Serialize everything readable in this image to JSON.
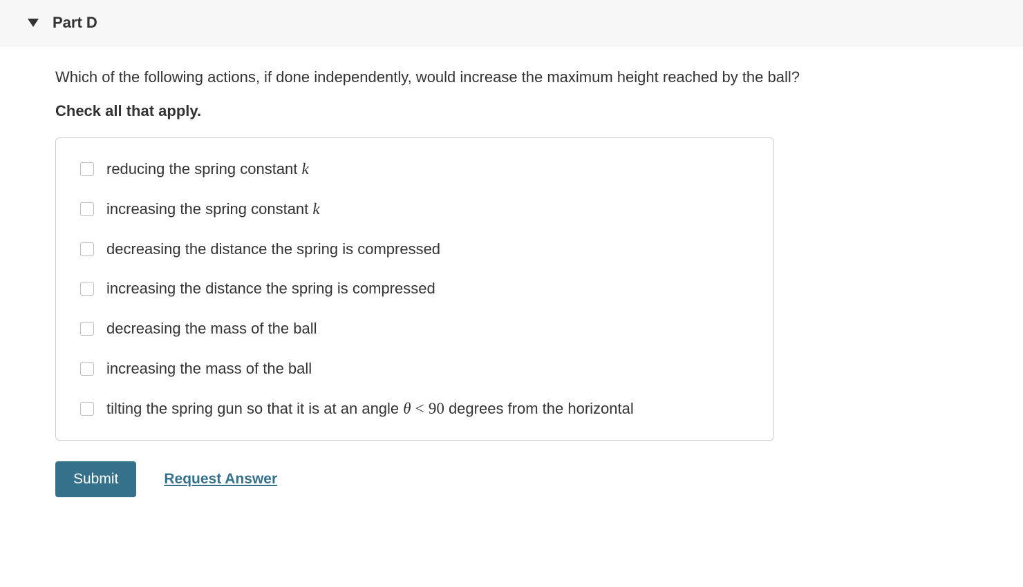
{
  "header": {
    "part_title": "Part D"
  },
  "question": {
    "text": "Which of the following actions, if done independently, would increase the maximum height reached by the ball?",
    "instruction": "Check all that apply."
  },
  "options": [
    {
      "text_before": "reducing the spring constant ",
      "math": "k",
      "text_after": ""
    },
    {
      "text_before": "increasing the spring constant ",
      "math": "k",
      "text_after": ""
    },
    {
      "text_before": "decreasing the distance the spring is compressed",
      "math": "",
      "text_after": ""
    },
    {
      "text_before": "increasing the distance the spring is compressed",
      "math": "",
      "text_after": ""
    },
    {
      "text_before": "decreasing the mass of the ball",
      "math": "",
      "text_after": ""
    },
    {
      "text_before": "increasing the mass of the ball",
      "math": "",
      "text_after": ""
    },
    {
      "text_before": "tilting the spring gun so that it is at an angle ",
      "math": "θ < 90",
      "text_after": " degrees from the horizontal"
    }
  ],
  "actions": {
    "submit_label": "Submit",
    "request_label": "Request Answer"
  }
}
